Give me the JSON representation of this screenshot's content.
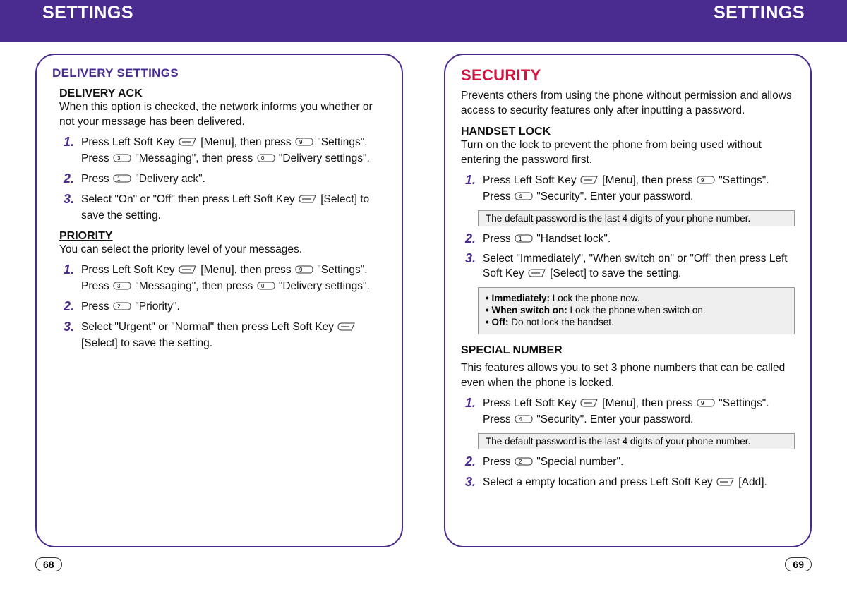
{
  "header": {
    "left": "SETTINGS",
    "right": "SETTINGS"
  },
  "left": {
    "title": "DELIVERY SETTINGS",
    "ack": {
      "head": "DELIVERY ACK",
      "desc": "When this option is checked, the network informs you whether or not your message has been delivered.",
      "s1a": "Press Left Soft Key ",
      "s1b": " [Menu], then press ",
      "s1c": " \"Settings\". Press ",
      "s1d": " \"Messaging\", then press ",
      "s1e": " \"Delivery settings\".",
      "s2a": "Press ",
      "s2b": " \"Delivery ack\".",
      "s3a": "Select \"On\" or \"Off\" then press Left Soft Key ",
      "s3b": " [Select] to save the setting."
    },
    "prio": {
      "head": "PRIORITY",
      "desc": "You can select the priority level of your messages.",
      "s1a": "Press Left Soft Key ",
      "s1b": " [Menu], then press ",
      "s1c": " \"Settings\". Press ",
      "s1d": " \"Messaging\", then press ",
      "s1e": " \"Delivery settings\".",
      "s2a": "Press ",
      "s2b": " \"Priority\".",
      "s3a": "Select \"Urgent\" or \"Normal\" then press Left Soft Key ",
      "s3b": " [Select] to save the setting."
    }
  },
  "right": {
    "title": "SECURITY",
    "lead": "Prevents others from using the phone without permission and allows access to security features only after inputting a password.",
    "lock": {
      "head": "HANDSET LOCK",
      "desc": "Turn on the lock to prevent the phone from being used without entering the password first.",
      "s1a": "Press Left Soft Key ",
      "s1b": " [Menu], then press ",
      "s1c": " \"Settings\". Press ",
      "s1d": " \"Security\". Enter your password.",
      "note": "The default password is the last 4 digits of your phone number.",
      "s2a": "Press ",
      "s2b": " \"Handset lock\".",
      "s3a": "Select \"Immediately\", \"When switch on\" or \"Off\" then press Left Soft Key ",
      "s3b": " [Select] to save the setting.",
      "opt1l": "• Immediately:",
      "opt1t": " Lock the phone now.",
      "opt2l": "• When switch on:",
      "opt2t": " Lock the phone when switch on.",
      "opt3l": "• Off:",
      "opt3t": " Do not lock the handset."
    },
    "special": {
      "head": "SPECIAL NUMBER",
      "desc": "This features allows you to set 3 phone numbers that can be called even when the phone is locked.",
      "s1a": "Press Left Soft Key ",
      "s1b": " [Menu], then press ",
      "s1c": " \"Settings\". Press ",
      "s1d": " \"Security\". Enter your password.",
      "note": "The default password is the last 4 digits of your phone number.",
      "s2a": "Press ",
      "s2b": " \"Special number\".",
      "s3a": "Select a empty location and press Left Soft Key ",
      "s3b": " [Add]."
    }
  },
  "nums": {
    "n1": "1.",
    "n2": "2.",
    "n3": "3."
  },
  "pages": {
    "left": "68",
    "right": "69"
  },
  "keys": {
    "k0": "0",
    "k1": "1",
    "k2": "2",
    "k3": "3",
    "k4": "4",
    "k9": "9"
  }
}
